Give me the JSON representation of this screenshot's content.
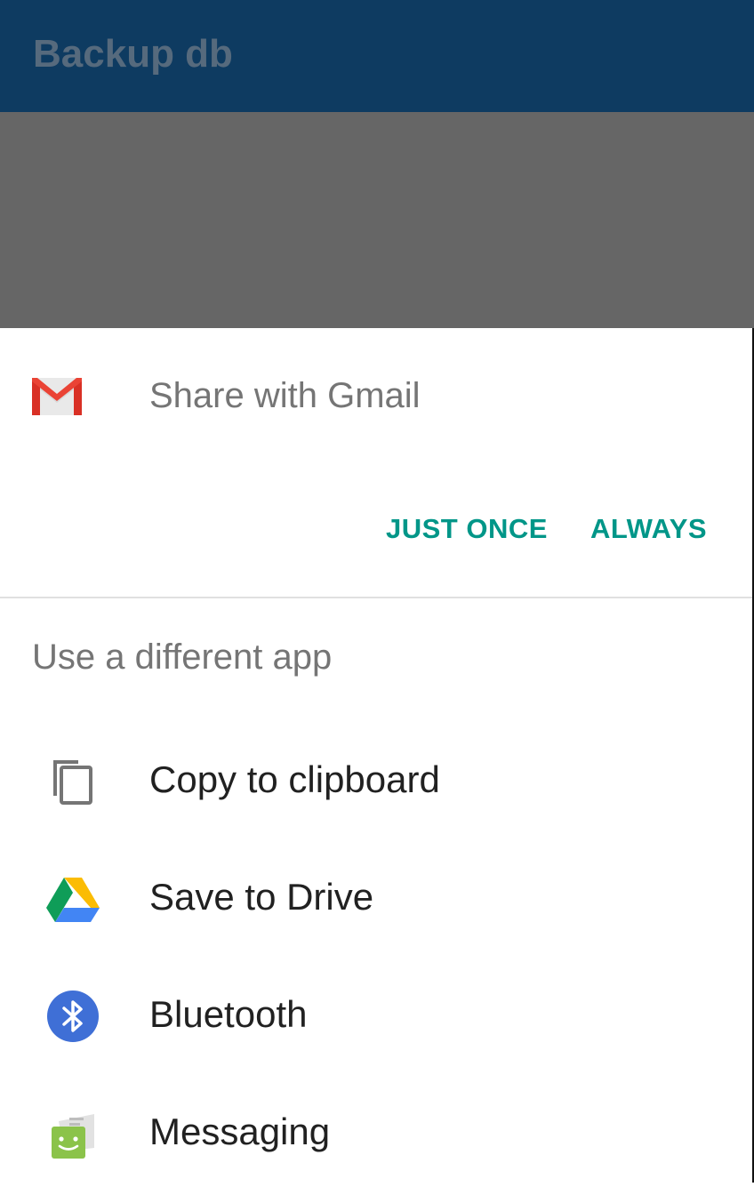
{
  "app_bar": {
    "title": "Backup db"
  },
  "share_sheet": {
    "default_app": {
      "label": "Share with Gmail",
      "icon": "gmail-icon"
    },
    "actions": {
      "just_once": "JUST ONCE",
      "always": "ALWAYS"
    },
    "section_title": "Use a different app",
    "apps": [
      {
        "label": "Copy to clipboard",
        "icon": "clipboard-icon"
      },
      {
        "label": "Save to Drive",
        "icon": "drive-icon"
      },
      {
        "label": "Bluetooth",
        "icon": "bluetooth-icon"
      },
      {
        "label": "Messaging",
        "icon": "messaging-icon"
      }
    ]
  },
  "colors": {
    "app_bar": "#0e3b61",
    "scrim": "#666666",
    "accent": "#009688",
    "secondary_text": "#757575",
    "primary_text": "#212121"
  }
}
